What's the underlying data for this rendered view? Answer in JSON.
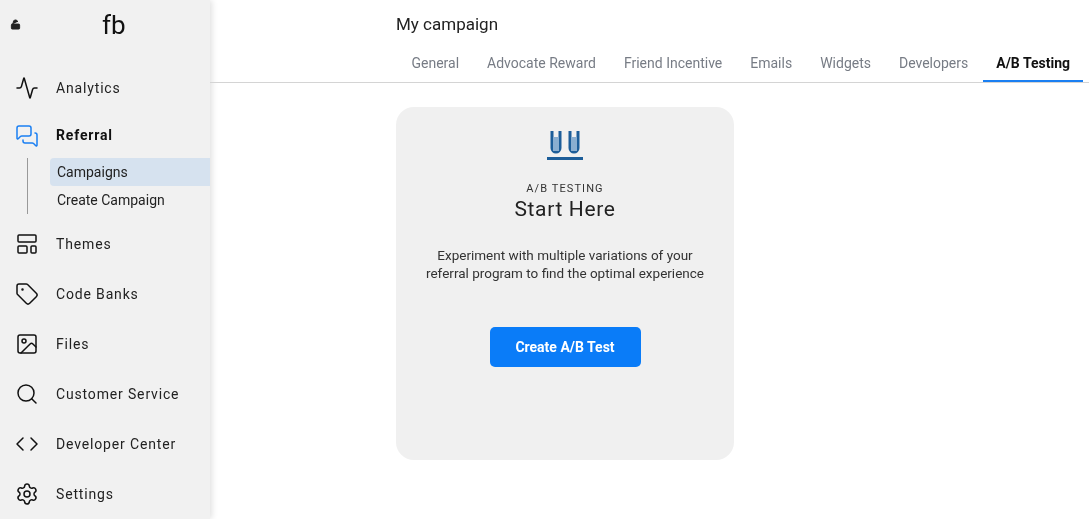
{
  "sidebar": {
    "logo": "fb",
    "items": [
      {
        "label": "Analytics",
        "selected": false
      },
      {
        "label": "Referral",
        "selected": true,
        "children": [
          {
            "label": "Campaigns",
            "selected": true
          },
          {
            "label": "Create Campaign",
            "selected": false
          }
        ]
      },
      {
        "label": "Themes",
        "selected": false
      },
      {
        "label": "Code Banks",
        "selected": false
      },
      {
        "label": "Files",
        "selected": false
      },
      {
        "label": "Customer Service",
        "selected": false
      },
      {
        "label": "Developer Center",
        "selected": false
      },
      {
        "label": "Settings",
        "selected": false
      }
    ]
  },
  "page": {
    "title": "My campaign",
    "tabs": [
      {
        "label": "General",
        "selected": false
      },
      {
        "label": "Advocate Reward",
        "selected": false
      },
      {
        "label": "Friend Incentive",
        "selected": false
      },
      {
        "label": "Emails",
        "selected": false
      },
      {
        "label": "Widgets",
        "selected": false
      },
      {
        "label": "Developers",
        "selected": false
      },
      {
        "label": "A/B Testing",
        "selected": true
      }
    ]
  },
  "card": {
    "eyebrow": "A/B TESTING",
    "heading": "Start Here",
    "description": "Experiment with multiple variations of your referral program to find the optimal experience",
    "button": "Create A/B Test"
  }
}
